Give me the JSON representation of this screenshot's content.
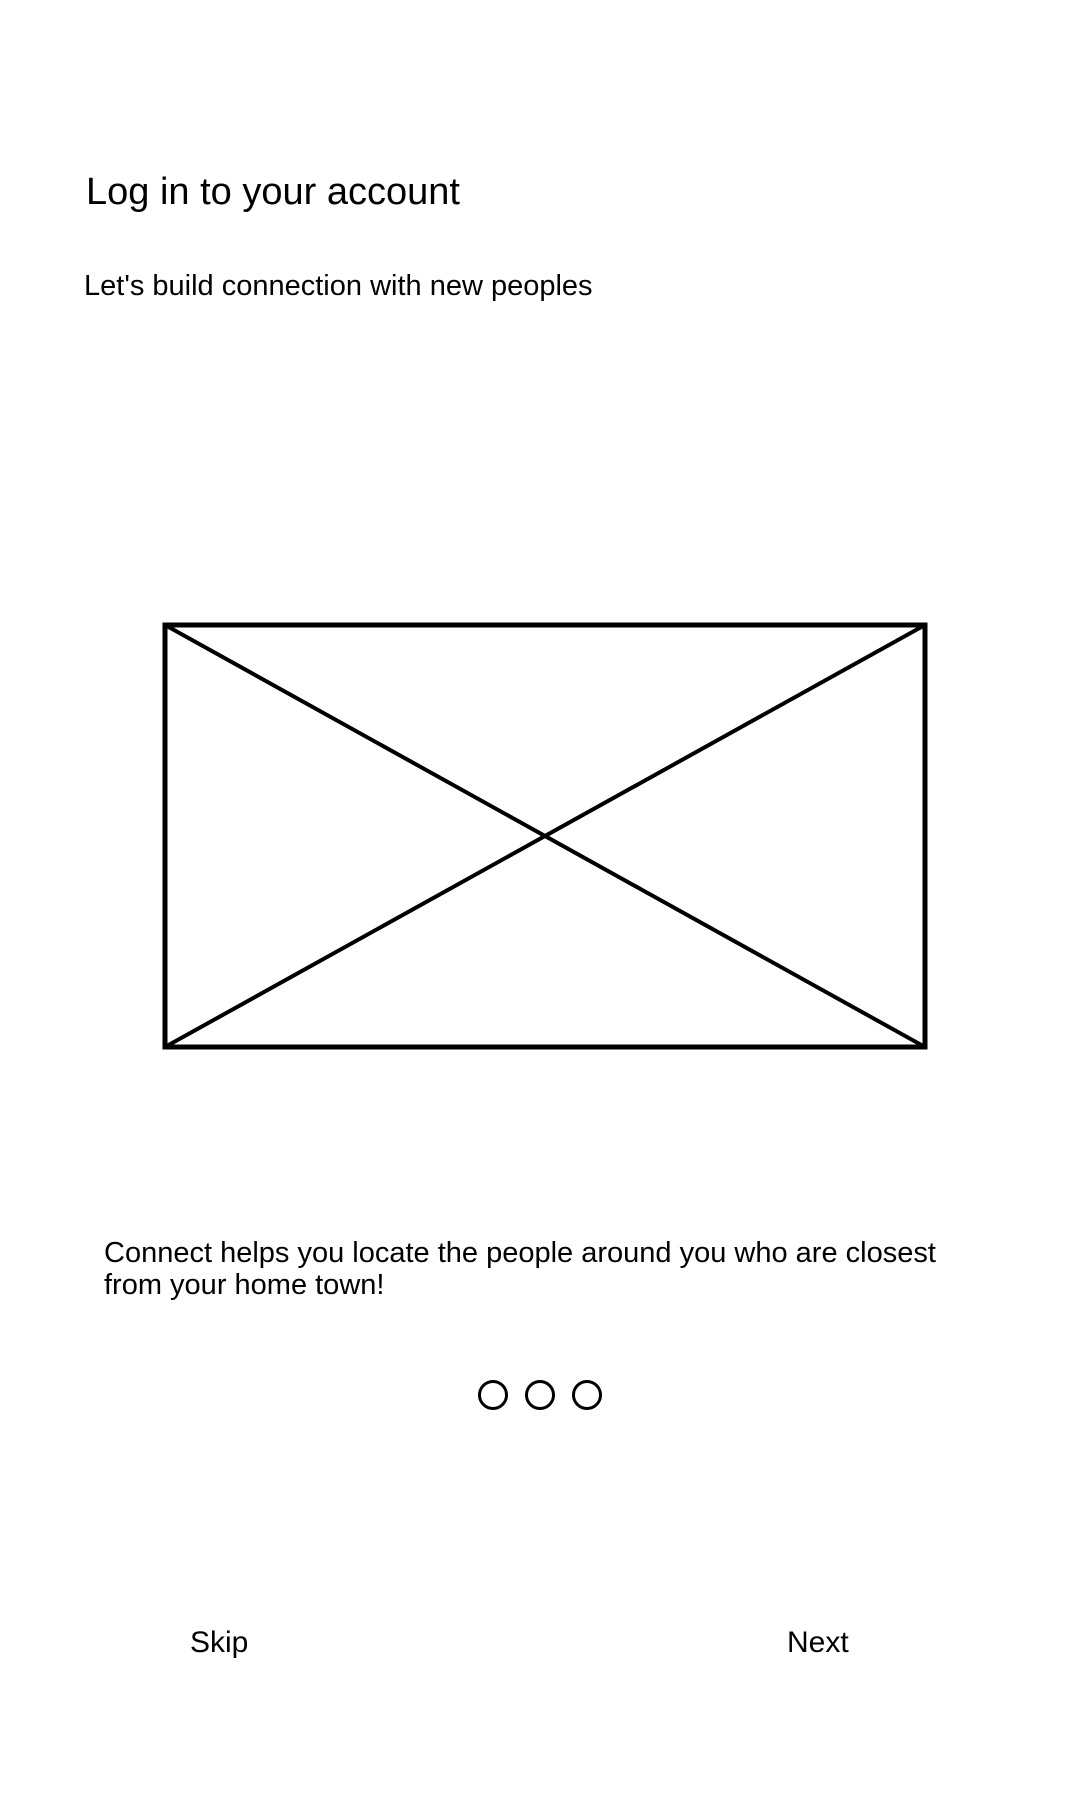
{
  "header": {
    "title": "Log in to your account",
    "subtitle": "Let's build connection with new peoples"
  },
  "hero": {
    "icon": "image-placeholder-icon"
  },
  "body": {
    "description": "Connect helps you locate the people around you who are closest from your home town!"
  },
  "pagination": {
    "total": 3,
    "icon": "circle-outline-icon"
  },
  "footer": {
    "skip_label": "Skip",
    "next_label": "Next"
  },
  "colors": {
    "background": "#ffffff",
    "stroke": "#000000"
  }
}
